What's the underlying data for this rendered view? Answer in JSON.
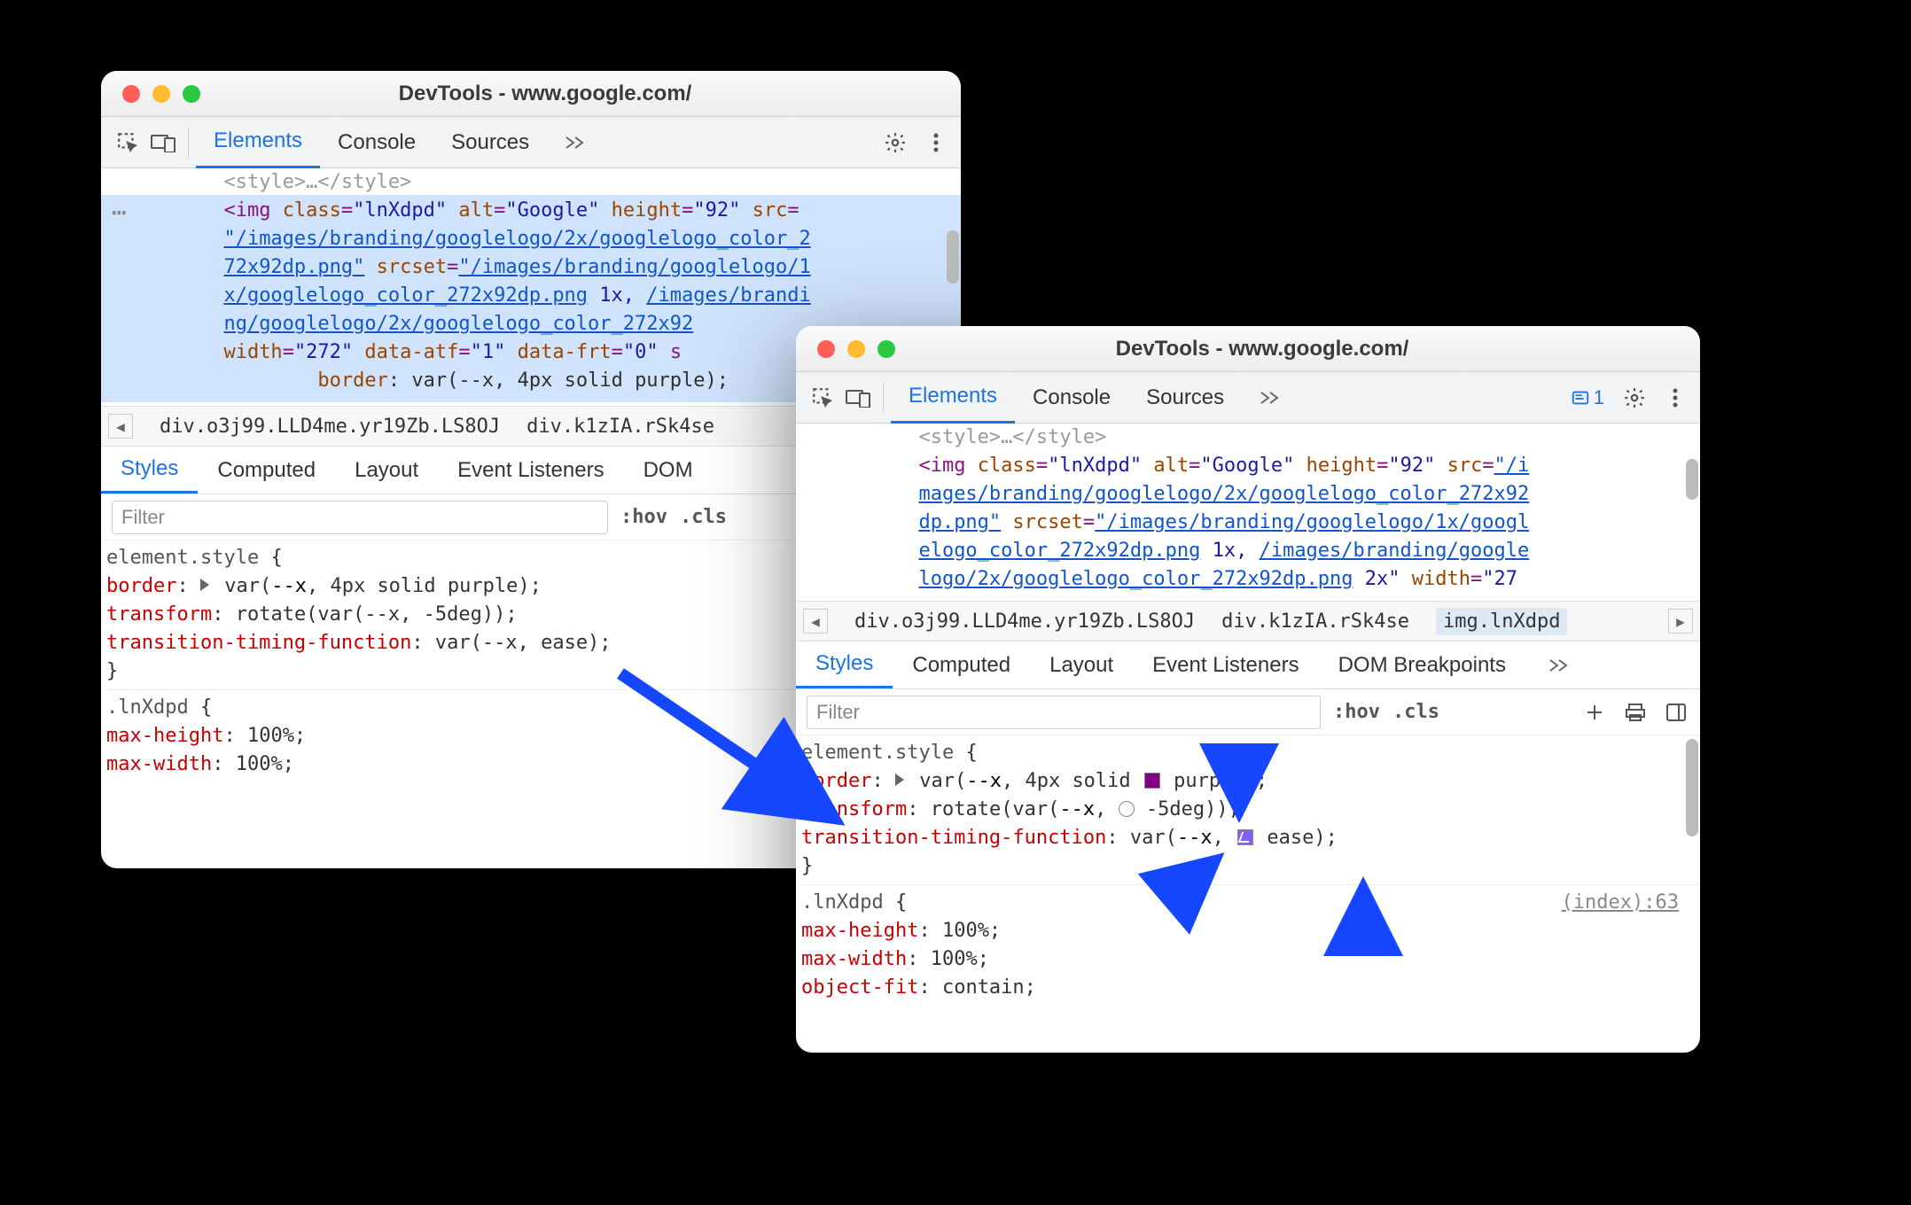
{
  "windows": {
    "left": {
      "title": "DevTools - www.google.com/",
      "tabs": {
        "elements": "Elements",
        "console": "Console",
        "sources": "Sources"
      },
      "dom": {
        "style_close": "<style>…</style>",
        "img_open_pre": "<img ",
        "img_class_label": "class",
        "img_class_val": "\"lnXdpd\"",
        "img_alt_label": "alt",
        "img_alt_val": "\"Google\"",
        "img_height_label": "height",
        "img_height_val": "\"92\"",
        "img_src_label": "src",
        "src_line1": "\"/images/branding/googlelogo/2x/googlelogo_color_2",
        "src_line2": "72x92dp.png\"",
        "srcset_label": "srcset",
        "srcset_l1": "\"/images/branding/googlelogo/1",
        "srcset_l2": "x/googlelogo_color_272x92dp.png",
        "srcset_l2_rest": " 1x, ",
        "srcset_l3": "/images/brandi",
        "srcset_l4": "ng/googlelogo/2x/googlelogo_color_272x92",
        "width_label": "width",
        "width_val": "\"272\"",
        "data_atf_l": "data-atf",
        "data_atf_v": "\"1\"",
        "data_frt_l": "data-frt",
        "data_frt_v": "\"0\"",
        "s_cut": " s",
        "border_label": "border",
        "border_val": "var(--x, 4px solid purple);"
      },
      "breadcrumbs": {
        "a": "div.o3j99.LLD4me.yr19Zb.LS8OJ",
        "b": "div.k1zIA.rSk4se"
      },
      "subtabs": {
        "styles": "Styles",
        "computed": "Computed",
        "layout": "Layout",
        "el": "Event Listeners",
        "dom": "DOM "
      },
      "filter_placeholder": "Filter",
      "hov": ":hov",
      "cls": ".cls",
      "styles": {
        "sel": "element.style",
        "p1": "border",
        "v1_pre": " var(",
        "v1_mid": "--x",
        "v1_post": ", 4px solid purple);",
        "p2": "transform",
        "v2": "rotate(var(--x, -5deg));",
        "p3": "transition-timing-function",
        "v3": "var(--x, ease);",
        "sel2": ".lnXdpd",
        "mh_p": "max-height",
        "mh_v": "100%;",
        "mw_p": "max-width",
        "mw_v": "100%;"
      }
    },
    "right": {
      "title": "DevTools - www.google.com/",
      "tabs": {
        "elements": "Elements",
        "console": "Console",
        "sources": "Sources"
      },
      "chip_count": "1",
      "dom": {
        "img_open_pre": "<img ",
        "img_class_label": "class",
        "img_class_val": "\"lnXdpd\"",
        "img_alt_label": "alt",
        "img_alt_val": "\"Google\"",
        "img_height_label": "height",
        "img_height_val": "\"92\"",
        "img_src_label": "src",
        "src1": "\"/i",
        "src2": "mages/branding/googlelogo/2x/googlelogo_color_272x92",
        "src3": "dp.png\"",
        "srcset_label": "srcset",
        "ss1": "\"/images/branding/googlelogo/1x/googl",
        "ss2": "elogo_color_272x92dp.png",
        "ss2_rest": " 1x, ",
        "ss3": "/images/branding/google",
        "ss4": "logo/2x/googlelogo_color_272x92dp.png",
        "ss4_rest": " 2x\"",
        "width_label": "width",
        "width_val": "\"27"
      },
      "breadcrumbs": {
        "a": "div.o3j99.LLD4me.yr19Zb.LS8OJ",
        "b": "div.k1zIA.rSk4se",
        "c": "img.lnXdpd"
      },
      "subtabs": {
        "styles": "Styles",
        "computed": "Computed",
        "layout": "Layout",
        "el": "Event Listeners",
        "dom": "DOM Breakpoints"
      },
      "filter_placeholder": "Filter",
      "hov": ":hov",
      "cls": ".cls",
      "styles": {
        "sel": "element.style",
        "p1": "border",
        "v1a": " var(",
        "v1b": "--x",
        "v1c": ", 4px solid ",
        "v1d": "purple);",
        "p2": "transform",
        "v2a": "rotate(var(",
        "v2b": "--x",
        "v2c": ", ",
        "v2d": "-5deg));",
        "p3": "transition-timing-function",
        "v3a": "var(",
        "v3b": "--x",
        "v3c": ", ",
        "v3d": "ease);",
        "sel2": ".lnXdpd",
        "srclink": "(index):63",
        "mh_p": "max-height",
        "mh_v": "100%;",
        "mw_p": "max-width",
        "mw_v": "100%;",
        "of_p": "object-fit",
        "of_v": "contain;"
      }
    }
  }
}
